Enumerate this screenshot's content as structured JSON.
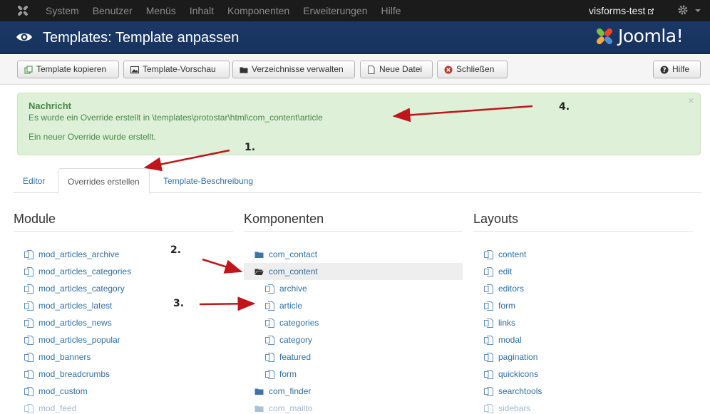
{
  "topbar": {
    "menu": [
      "System",
      "Benutzer",
      "Menüs",
      "Inhalt",
      "Komponenten",
      "Erweiterungen",
      "Hilfe"
    ],
    "site_name": "visforms-test"
  },
  "header": {
    "title": "Templates: Template anpassen",
    "brand": "Joomla!"
  },
  "toolbar": {
    "copy": "Template kopieren",
    "preview": "Template-Vorschau",
    "folders": "Verzeichnisse verwalten",
    "new_file": "Neue Datei",
    "close": "Schließen",
    "help": "Hilfe"
  },
  "alert": {
    "heading": "Nachricht",
    "message1": "Es wurde ein Override erstellt in \\templates\\protostar\\html\\com_content\\article",
    "message2": "Ein neuer Override wurde erstellt.",
    "close": "×"
  },
  "tabs": [
    "Editor",
    "Overrides erstellen",
    "Template-Beschreibung"
  ],
  "columns": {
    "modules": {
      "title": "Module",
      "items": [
        "mod_articles_archive",
        "mod_articles_categories",
        "mod_articles_category",
        "mod_articles_latest",
        "mod_articles_news",
        "mod_articles_popular",
        "mod_banners",
        "mod_breadcrumbs",
        "mod_custom",
        "mod_feed"
      ]
    },
    "components": {
      "title": "Komponenten",
      "items": [
        "com_contact",
        "com_content",
        "archive",
        "article",
        "categories",
        "category",
        "featured",
        "form",
        "com_finder",
        "com_mailto"
      ]
    },
    "layouts": {
      "title": "Layouts",
      "items": [
        "content",
        "edit",
        "editors",
        "form",
        "links",
        "modal",
        "pagination",
        "quickicons",
        "searchtools",
        "sidebars"
      ]
    }
  },
  "annotations": [
    "1.",
    "2.",
    "3.",
    "4."
  ],
  "colors": {
    "topbar": "#1b1b1b",
    "header": "#1a3867",
    "link": "#2f6fa3",
    "alert_bg": "#dff0d8",
    "alert_text": "#468847",
    "arrow": "#c0151b"
  }
}
